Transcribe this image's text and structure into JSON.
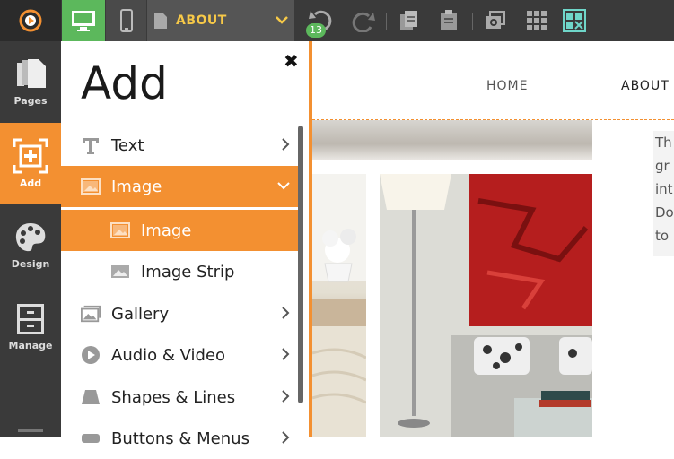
{
  "toolbar": {
    "page_name": "ABOUT",
    "undo_count": "13",
    "icons": [
      "logo-icon",
      "desktop-icon",
      "mobile-icon",
      "page-icon",
      "chevron-down-icon",
      "undo-icon",
      "redo-icon",
      "copy-icon",
      "paste-icon",
      "preview-icon",
      "grid-icon",
      "layout-icon"
    ]
  },
  "leftbar": {
    "items": [
      {
        "label": "Pages",
        "icon": "pages-icon"
      },
      {
        "label": "Add",
        "icon": "add-icon",
        "active": true
      },
      {
        "label": "Design",
        "icon": "palette-icon"
      },
      {
        "label": "Manage",
        "icon": "cabinet-icon"
      }
    ]
  },
  "add_panel": {
    "title": "Add",
    "items": [
      {
        "label": "Text",
        "icon": "text-icon",
        "expand": "chevron-right-icon"
      },
      {
        "label": "Image",
        "icon": "image-icon",
        "expand": "chevron-down-icon",
        "active": true
      },
      {
        "label": "Image",
        "icon": "image-icon",
        "sub": true,
        "active": true
      },
      {
        "label": "Image Strip",
        "icon": "image-strip-icon",
        "sub": true
      },
      {
        "label": "Gallery",
        "icon": "gallery-icon",
        "expand": "chevron-right-icon"
      },
      {
        "label": "Audio & Video",
        "icon": "play-icon",
        "expand": "chevron-right-icon"
      },
      {
        "label": "Shapes & Lines",
        "icon": "shapes-icon",
        "expand": "chevron-right-icon"
      },
      {
        "label": "Buttons & Menus",
        "icon": "buttons-icon",
        "expand": "chevron-right-icon"
      }
    ]
  },
  "site": {
    "nav_home": "HOME",
    "nav_about": "ABOUT",
    "text_lines": [
      "Th",
      "gr",
      "int",
      "Do",
      "to"
    ]
  },
  "colors": {
    "accent": "#f39031",
    "green": "#5cb85c",
    "toolbar": "#3a3a3a",
    "page_label": "#f7c948"
  }
}
